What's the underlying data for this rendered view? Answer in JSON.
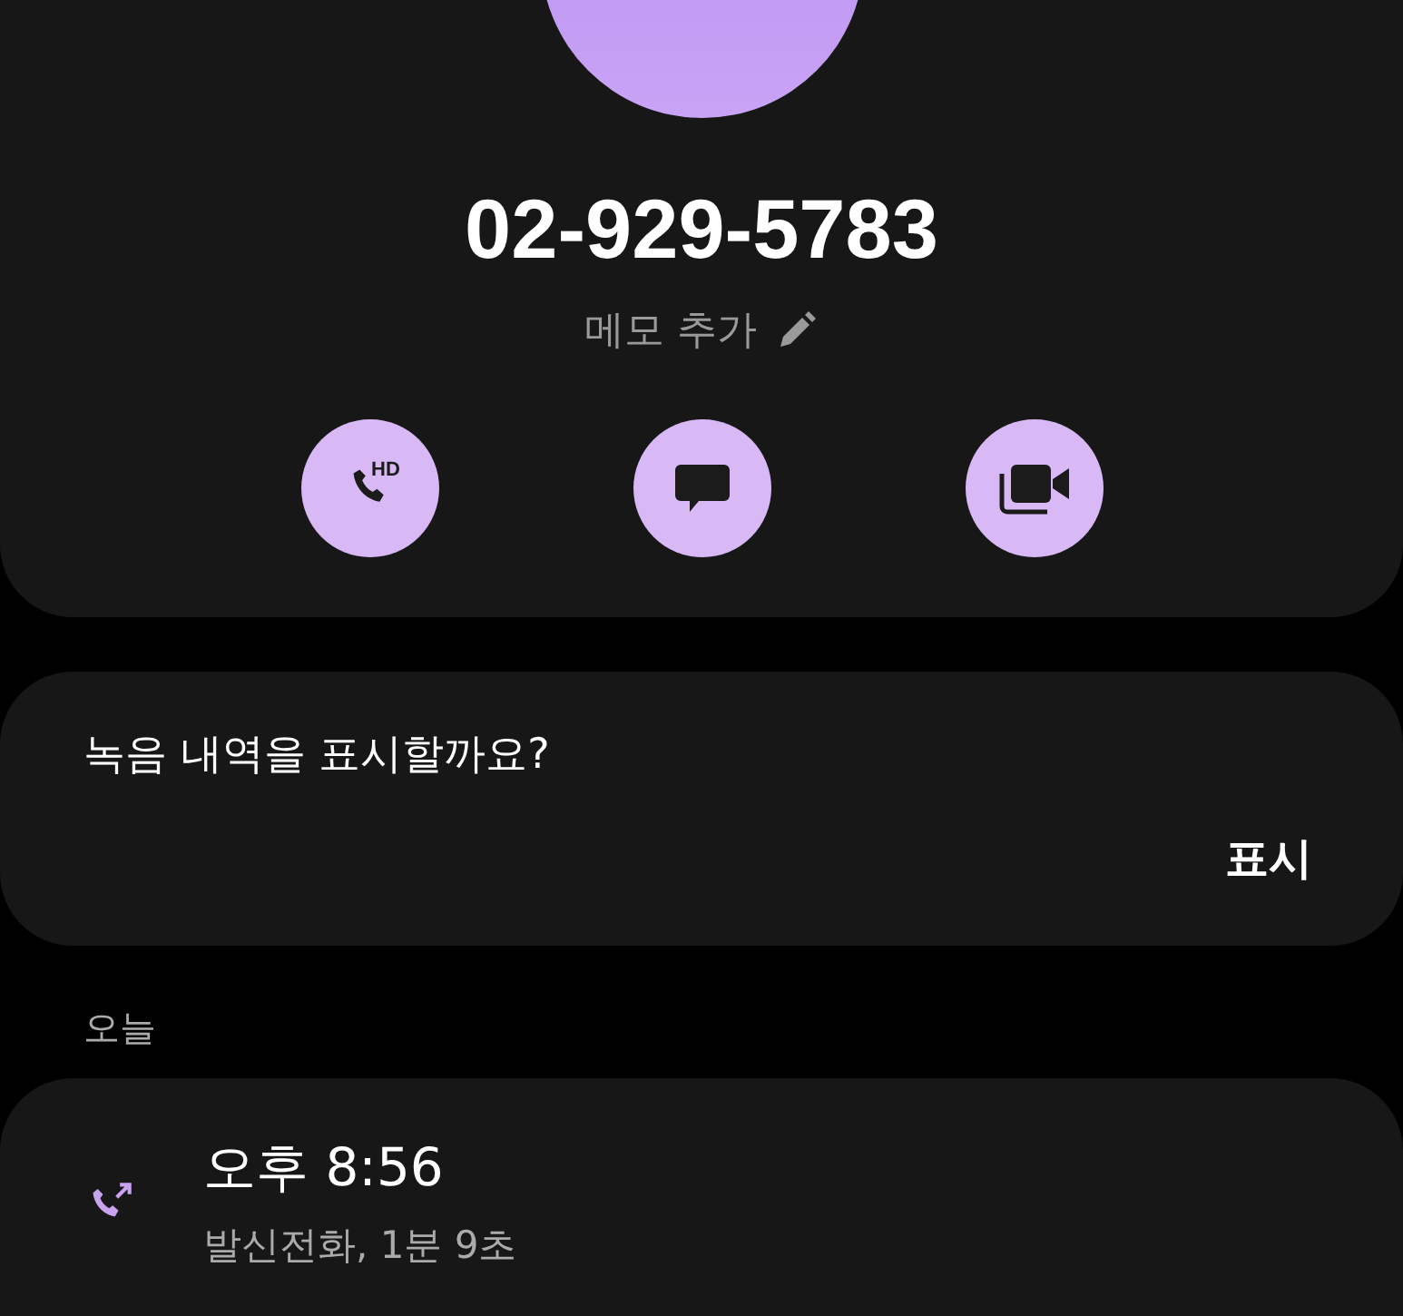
{
  "contact": {
    "number": "02-929-5783",
    "memo": "메모 추가",
    "hd_badge": "HD"
  },
  "actions": [
    {
      "kind": "call"
    },
    {
      "kind": "message"
    },
    {
      "kind": "video"
    }
  ],
  "recording_prompt": {
    "question": "녹음 내역을 표시할까요?",
    "button": "표시"
  },
  "section": "오늘",
  "calls": [
    {
      "kind": "outgoing",
      "time": "오후 8:56",
      "detail": "발신전화, 1분 9초"
    }
  ]
}
